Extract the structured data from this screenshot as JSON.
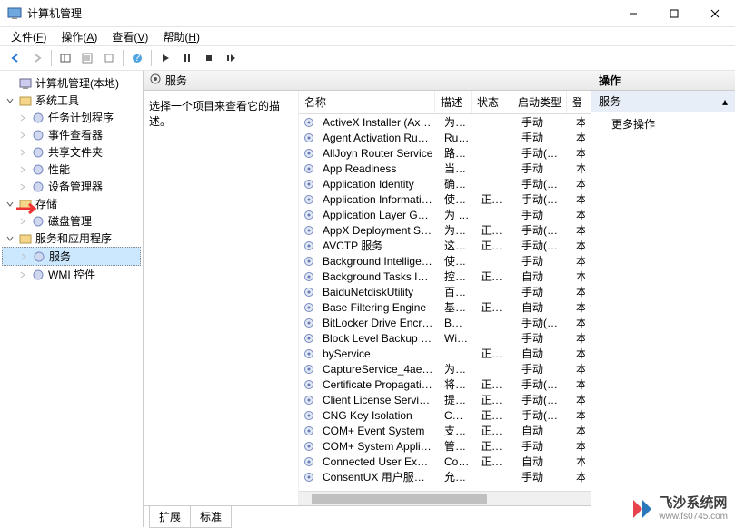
{
  "window": {
    "title": "计算机管理"
  },
  "menubar": [
    {
      "label": "文件",
      "key": "F"
    },
    {
      "label": "操作",
      "key": "A"
    },
    {
      "label": "查看",
      "key": "V"
    },
    {
      "label": "帮助",
      "key": "H"
    }
  ],
  "tree": {
    "root": "计算机管理(本地)",
    "groups": [
      {
        "label": "系统工具",
        "expanded": true,
        "children": [
          {
            "label": "任务计划程序"
          },
          {
            "label": "事件查看器"
          },
          {
            "label": "共享文件夹"
          },
          {
            "label": "性能"
          },
          {
            "label": "设备管理器"
          }
        ]
      },
      {
        "label": "存储",
        "expanded": true,
        "children": [
          {
            "label": "磁盘管理"
          }
        ]
      },
      {
        "label": "服务和应用程序",
        "expanded": true,
        "children": [
          {
            "label": "服务",
            "selected": true
          },
          {
            "label": "WMI 控件"
          }
        ]
      }
    ]
  },
  "mid": {
    "title": "服务",
    "prompt": "选择一个项目来查看它的描述。",
    "columns": {
      "name": "名称",
      "desc": "描述",
      "status": "状态",
      "start": "启动类型",
      "last": "登"
    },
    "tabs": [
      "扩展",
      "标准"
    ]
  },
  "actions": {
    "header": "操作",
    "section": "服务",
    "items": [
      "更多操作"
    ]
  },
  "services": [
    {
      "name": "ActiveX Installer (AxInstSV)",
      "desc": "为从 ...",
      "status": "",
      "start": "手动",
      "l": "本"
    },
    {
      "name": "Agent Activation Runtime ...",
      "desc": "Runt...",
      "status": "",
      "start": "手动",
      "l": "本"
    },
    {
      "name": "AllJoyn Router Service",
      "desc": "路由 ...",
      "status": "",
      "start": "手动(触发...",
      "l": "本"
    },
    {
      "name": "App Readiness",
      "desc": "当用 ...",
      "status": "",
      "start": "手动",
      "l": "本"
    },
    {
      "name": "Application Identity",
      "desc": "确定 ...",
      "status": "",
      "start": "手动(触发...",
      "l": "本"
    },
    {
      "name": "Application Information",
      "desc": "使用 ...",
      "status": "正在 ...",
      "start": "手动(触发...",
      "l": "本"
    },
    {
      "name": "Application Layer Gateway ...",
      "desc": "为 In...",
      "status": "",
      "start": "手动",
      "l": "本"
    },
    {
      "name": "AppX Deployment Service (...",
      "desc": "为部 ...",
      "status": "正在 ...",
      "start": "手动(触发...",
      "l": "本"
    },
    {
      "name": "AVCTP 服务",
      "desc": "这是 ...",
      "status": "正在 ...",
      "start": "手动(触发...",
      "l": "本"
    },
    {
      "name": "Background Intelligent Tra...",
      "desc": "使用 ...",
      "status": "",
      "start": "手动",
      "l": "本"
    },
    {
      "name": "Background Tasks Infrastru...",
      "desc": "控制 ...",
      "status": "正在 ...",
      "start": "自动",
      "l": "本"
    },
    {
      "name": "BaiduNetdiskUtility",
      "desc": "百度 ...",
      "status": "",
      "start": "手动",
      "l": "本"
    },
    {
      "name": "Base Filtering Engine",
      "desc": "基本 ...",
      "status": "正在 ...",
      "start": "自动",
      "l": "本"
    },
    {
      "name": "BitLocker Drive Encryption ...",
      "desc": "BDE...",
      "status": "",
      "start": "手动(触发...",
      "l": "本"
    },
    {
      "name": "Block Level Backup Engine ...",
      "desc": "Win...",
      "status": "",
      "start": "手动",
      "l": "本"
    },
    {
      "name": "byService",
      "desc": "",
      "status": "正在 ...",
      "start": "自动",
      "l": "本"
    },
    {
      "name": "CaptureService_4aeb7ca",
      "desc": "为调 ...",
      "status": "",
      "start": "手动",
      "l": "本"
    },
    {
      "name": "Certificate Propagation",
      "desc": "将用 ...",
      "status": "正在 ...",
      "start": "手动(触发...",
      "l": "本"
    },
    {
      "name": "Client License Service (Clip...",
      "desc": "提供 ...",
      "status": "正在 ...",
      "start": "手动(触发...",
      "l": "本"
    },
    {
      "name": "CNG Key Isolation",
      "desc": "CNG ...",
      "status": "正在 ...",
      "start": "手动(触发...",
      "l": "本"
    },
    {
      "name": "COM+ Event System",
      "desc": "支持 ...",
      "status": "正在 ...",
      "start": "自动",
      "l": "本"
    },
    {
      "name": "COM+ System Application",
      "desc": "管理 ...",
      "status": "正在 ...",
      "start": "手动",
      "l": "本"
    },
    {
      "name": "Connected User Experienc...",
      "desc": "Con...",
      "status": "正在 ...",
      "start": "自动",
      "l": "本"
    },
    {
      "name": "ConsentUX 用户服务_4aeb...",
      "desc": "允许 ...",
      "status": "",
      "start": "手动",
      "l": "本"
    }
  ],
  "watermark": {
    "big": "飞沙系统网",
    "small": "www.fs0745.com"
  }
}
